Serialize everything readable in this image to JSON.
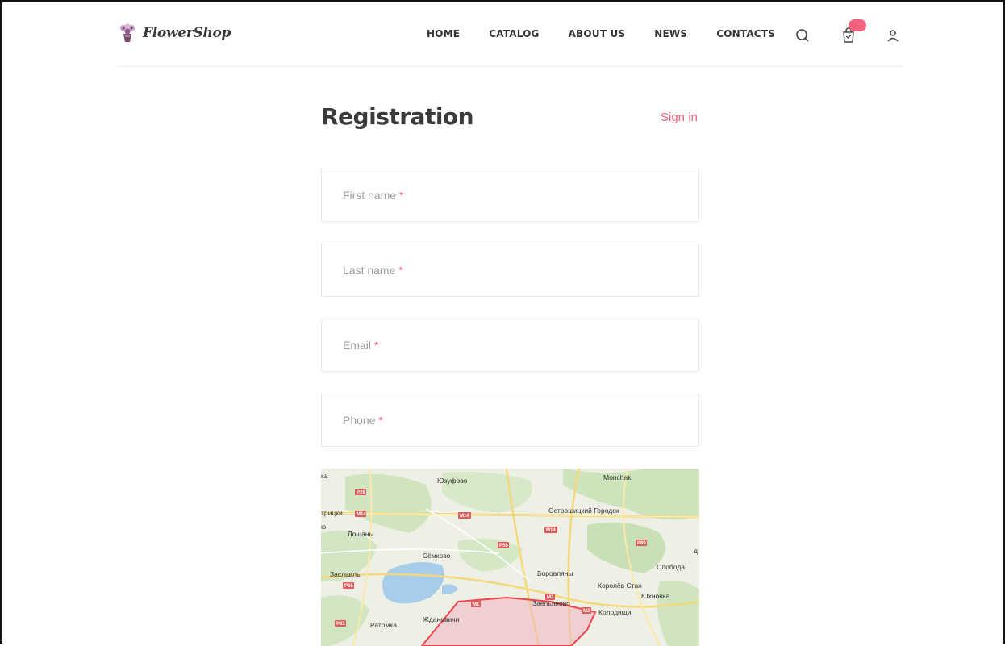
{
  "header": {
    "brand": "FlowerShop",
    "nav": [
      "HOME",
      "CATALOG",
      "ABOUT US",
      "NEWS",
      "CONTACTS"
    ],
    "icons": [
      "search-icon",
      "cart-icon",
      "user-icon"
    ]
  },
  "page": {
    "title": "Registration",
    "signin_link": "Sign in"
  },
  "form": {
    "first_name": "First name",
    "last_name": "Last name",
    "email": "Email",
    "phone": "Phone",
    "required_mark": "*"
  },
  "map": {
    "labels": [
      "Юзуфово",
      "Monchaki",
      "трицки",
      "Острошицкий Городок",
      "Лошаны",
      "Сёмково",
      "Слобода",
      "Заславль",
      "Боровляны",
      "Королёв Стан",
      "Юхновка",
      "Заельяново",
      "Колодищи",
      "Ждановичи",
      "Ратомка",
      "ка",
      "ю",
      "д"
    ],
    "roads": [
      "P28",
      "M14",
      "M14",
      "M14",
      "P58",
      "P80",
      "P65",
      "M3",
      "M2",
      "P65",
      "M1"
    ]
  },
  "colors": {
    "accent": "#f2627e",
    "text": "#333333",
    "placeholder": "#9b9b9b",
    "border": "#e6e6e6"
  }
}
